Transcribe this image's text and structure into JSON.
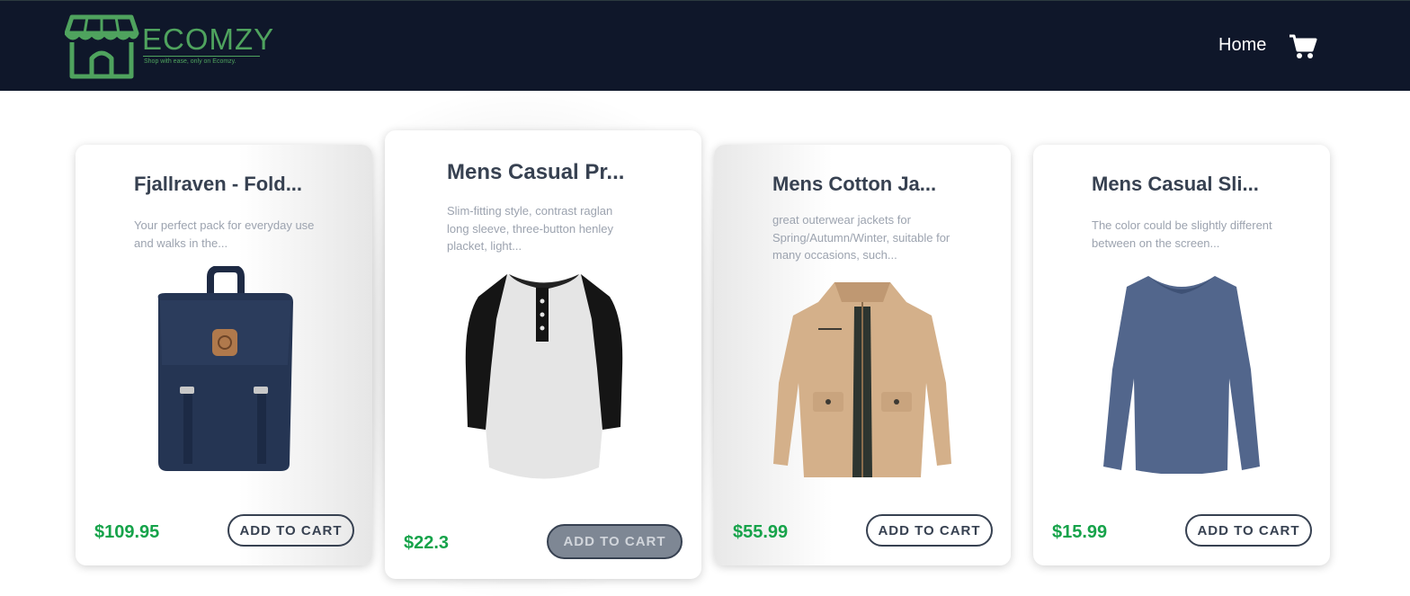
{
  "header": {
    "brand": "ECOMZY",
    "tagline": "Shop with ease, only on Ecomzy.",
    "nav_home": "Home",
    "cart_icon": "shopping-cart-icon",
    "colors": {
      "bar": "#0f172a",
      "brand": "#4fa35e"
    }
  },
  "products": [
    {
      "title": "Fjallraven - Fold...",
      "description": "Your perfect pack for everyday use and walks in the...",
      "price": "$109.95",
      "button": "ADD TO CART",
      "image": "backpack"
    },
    {
      "title": "Mens Casual Pr...",
      "description": "Slim-fitting style, contrast raglan long sleeve, three-button henley placket, light...",
      "price": "$22.3",
      "button": "ADD TO CART",
      "image": "raglan-henley-shirt"
    },
    {
      "title": "Mens Cotton Ja...",
      "description": "great outerwear jackets for Spring/Autumn/Winter, suitable for many occasions, such...",
      "price": "$55.99",
      "button": "ADD TO CART",
      "image": "cotton-jacket"
    },
    {
      "title": "Mens Casual Sli...",
      "description": "The color could be slightly different between on the screen...",
      "price": "$15.99",
      "button": "ADD TO CART",
      "image": "long-sleeve-tee"
    }
  ],
  "colors": {
    "price": "#16a34a",
    "title": "#374151",
    "desc": "#9ca3af"
  }
}
